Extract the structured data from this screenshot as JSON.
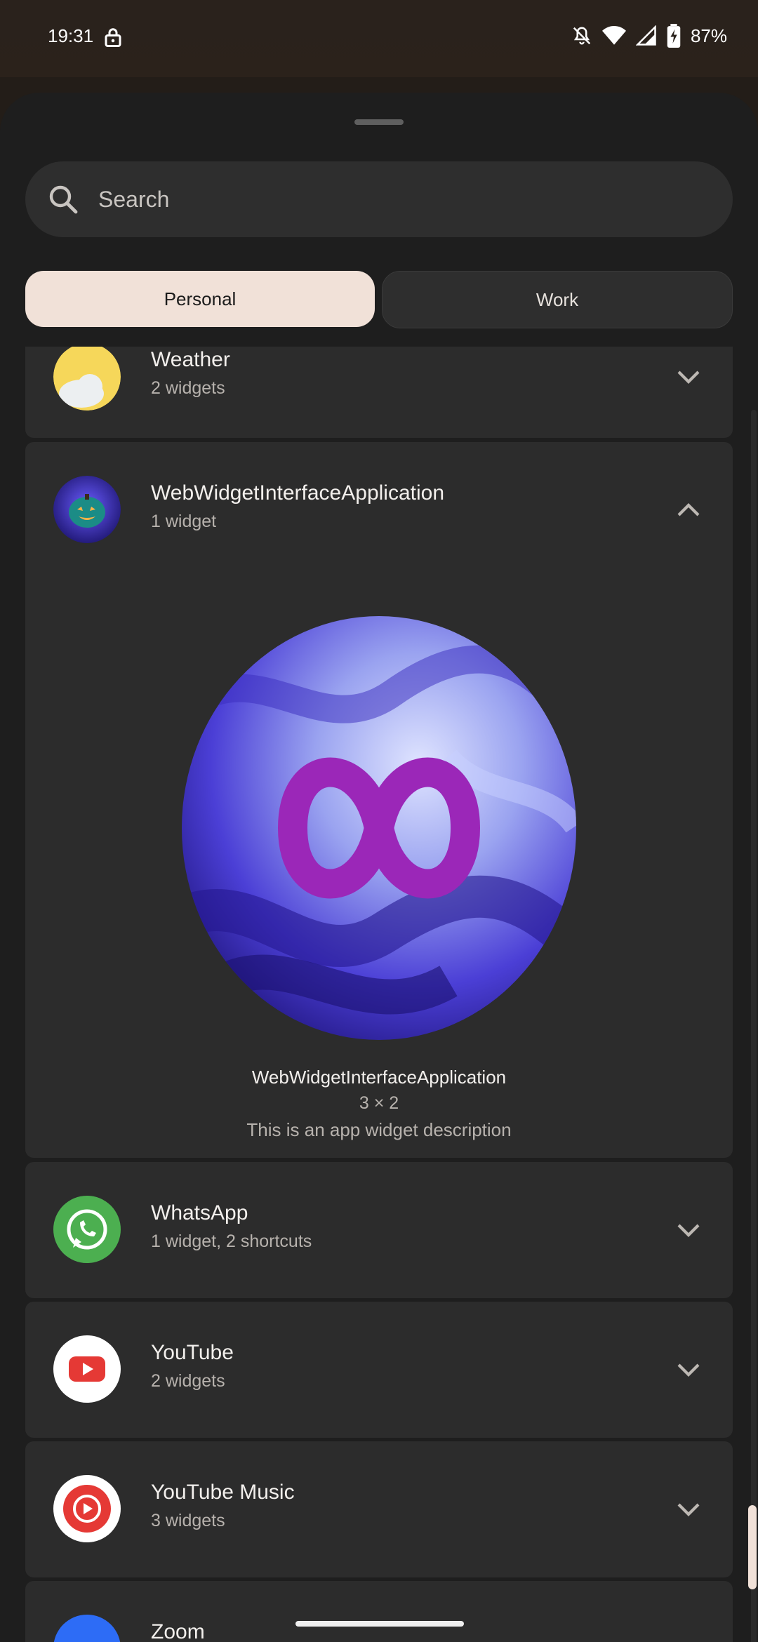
{
  "status": {
    "time": "19:31",
    "battery": "87%"
  },
  "search": {
    "placeholder": "Search"
  },
  "tabs": [
    {
      "label": "Personal"
    },
    {
      "label": "Work"
    }
  ],
  "apps": [
    {
      "name": "Weather",
      "sub": "2 widgets"
    },
    {
      "name": "WebWidgetInterfaceApplication",
      "sub": "1 widget"
    },
    {
      "name": "WhatsApp",
      "sub": "1 widget, 2 shortcuts"
    },
    {
      "name": "YouTube",
      "sub": "2 widgets"
    },
    {
      "name": "YouTube Music",
      "sub": "3 widgets"
    },
    {
      "name": "Zoom",
      "sub": ""
    }
  ],
  "widget_preview": {
    "title": "WebWidgetInterfaceApplication",
    "size": "3 × 2",
    "description": "This is an app widget description"
  },
  "colors": {
    "accent": "#f1e1d8",
    "infinity": "#9b27b8",
    "whatsapp": "#4caf50",
    "youtube": "#e53935"
  }
}
